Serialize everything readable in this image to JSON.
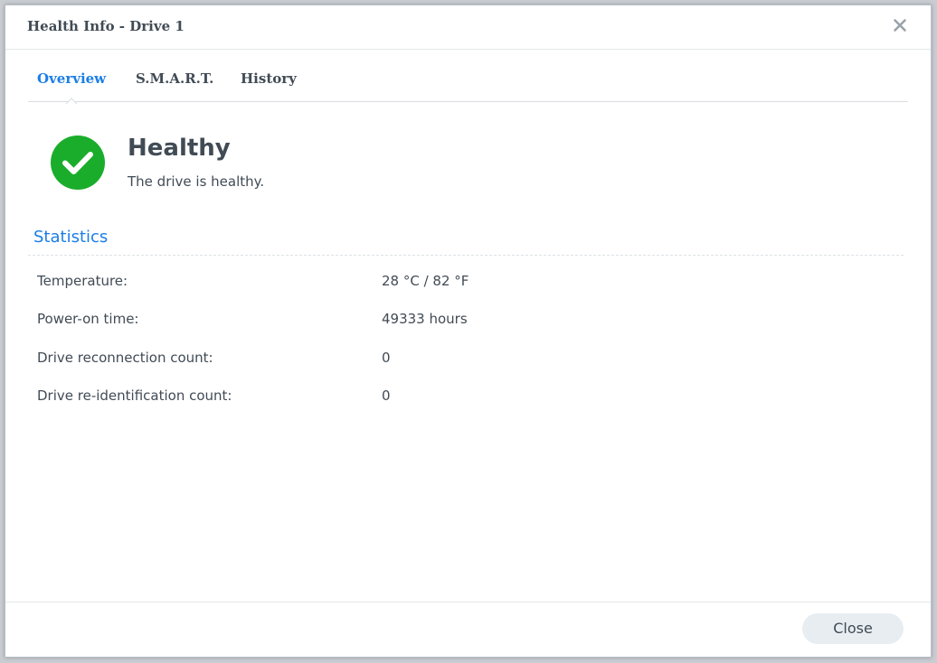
{
  "window": {
    "title": "Health Info - Drive 1",
    "close_icon": "close-icon"
  },
  "tabs": [
    {
      "label": "Overview",
      "active": true
    },
    {
      "label": "S.M.A.R.T.",
      "active": false
    },
    {
      "label": "History",
      "active": false
    }
  ],
  "status": {
    "icon": "checkmark-circle-icon",
    "color": "#1aad2b",
    "title": "Healthy",
    "description": "The drive is healthy."
  },
  "statistics": {
    "heading": "Statistics",
    "rows": [
      {
        "label": "Temperature:",
        "value": "28 °C / 82 °F"
      },
      {
        "label": "Power-on time:",
        "value": "49333 hours"
      },
      {
        "label": "Drive reconnection count:",
        "value": "0"
      },
      {
        "label": "Drive re-identification count:",
        "value": "0"
      }
    ]
  },
  "footer": {
    "close_label": "Close"
  },
  "colors": {
    "accent": "#1b7ee5",
    "text": "#414b55",
    "success": "#1aad2b"
  }
}
